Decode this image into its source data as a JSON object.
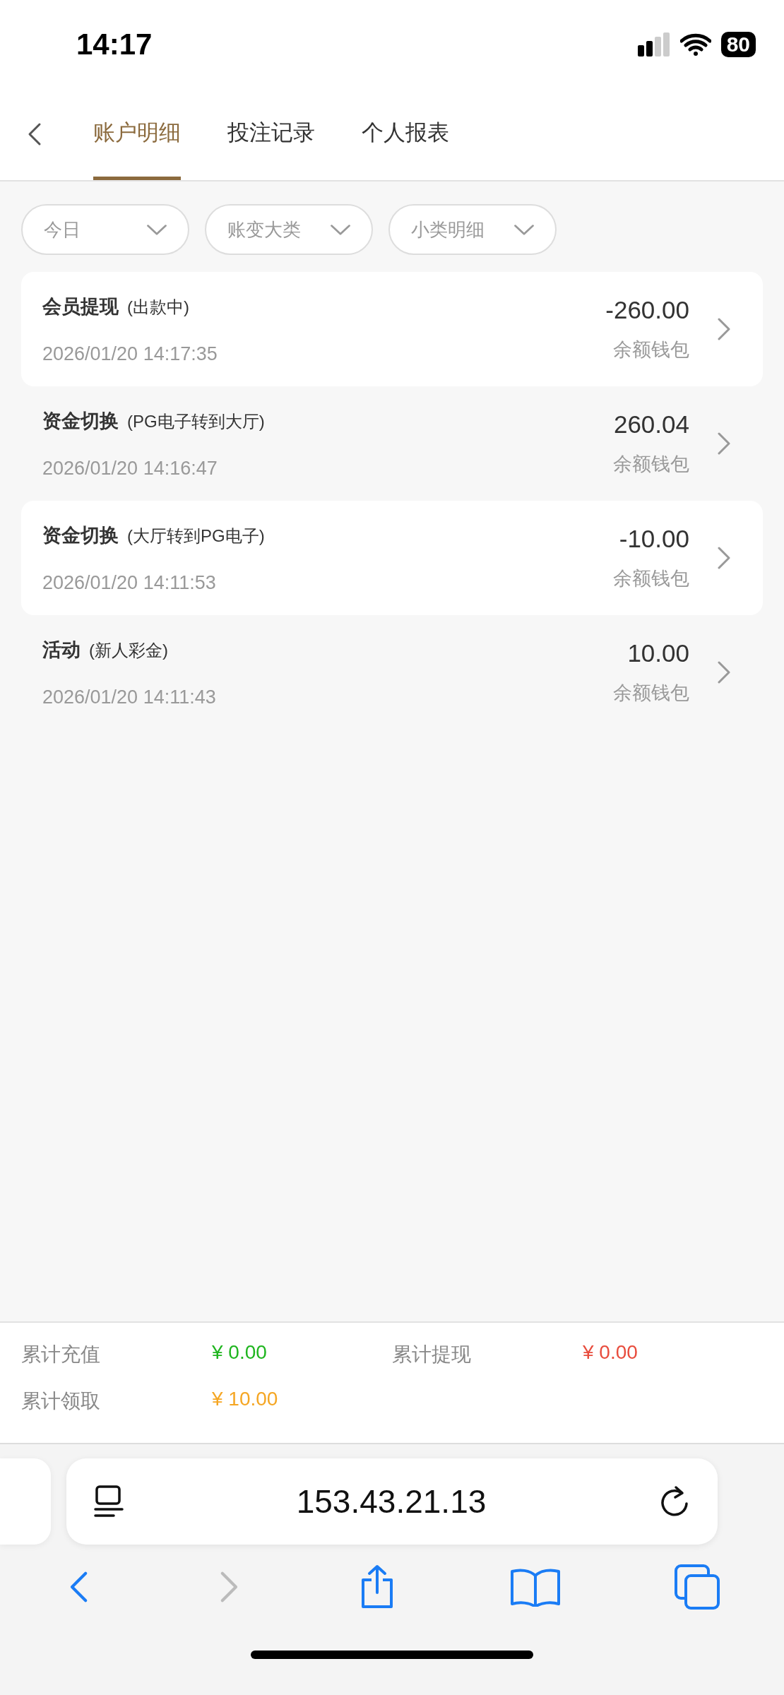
{
  "status_bar": {
    "time": "14:17",
    "battery": "80"
  },
  "tabs": [
    {
      "label": "账户明细",
      "selected": true
    },
    {
      "label": "投注记录",
      "selected": false
    },
    {
      "label": "个人报表",
      "selected": false
    }
  ],
  "filters": [
    "今日",
    "账变大类",
    "小类明细"
  ],
  "records": [
    {
      "title": "会员提现",
      "detail": "(出款中)",
      "time": "2026/01/20 14:17:35",
      "amount": "-260.00",
      "wallet": "余额钱包"
    },
    {
      "title": "资金切换",
      "detail": "(PG电子转到大厅)",
      "time": "2026/01/20 14:16:47",
      "amount": "260.04",
      "wallet": "余额钱包"
    },
    {
      "title": "资金切换",
      "detail": "(大厅转到PG电子)",
      "time": "2026/01/20 14:11:53",
      "amount": "-10.00",
      "wallet": "余额钱包"
    },
    {
      "title": "活动",
      "detail": "(新人彩金)",
      "time": "2026/01/20 14:11:43",
      "amount": "10.00",
      "wallet": "余额钱包"
    }
  ],
  "summary": [
    {
      "label": "累计充值",
      "value": "¥ 0.00",
      "color": "#1fb51f"
    },
    {
      "label": "累计提现",
      "value": "¥ 0.00",
      "color": "#e84c3d"
    },
    {
      "label": "累计领取",
      "value": "¥ 10.00",
      "color": "#f5a623"
    }
  ],
  "browser": {
    "url": "153.43.21.13"
  }
}
